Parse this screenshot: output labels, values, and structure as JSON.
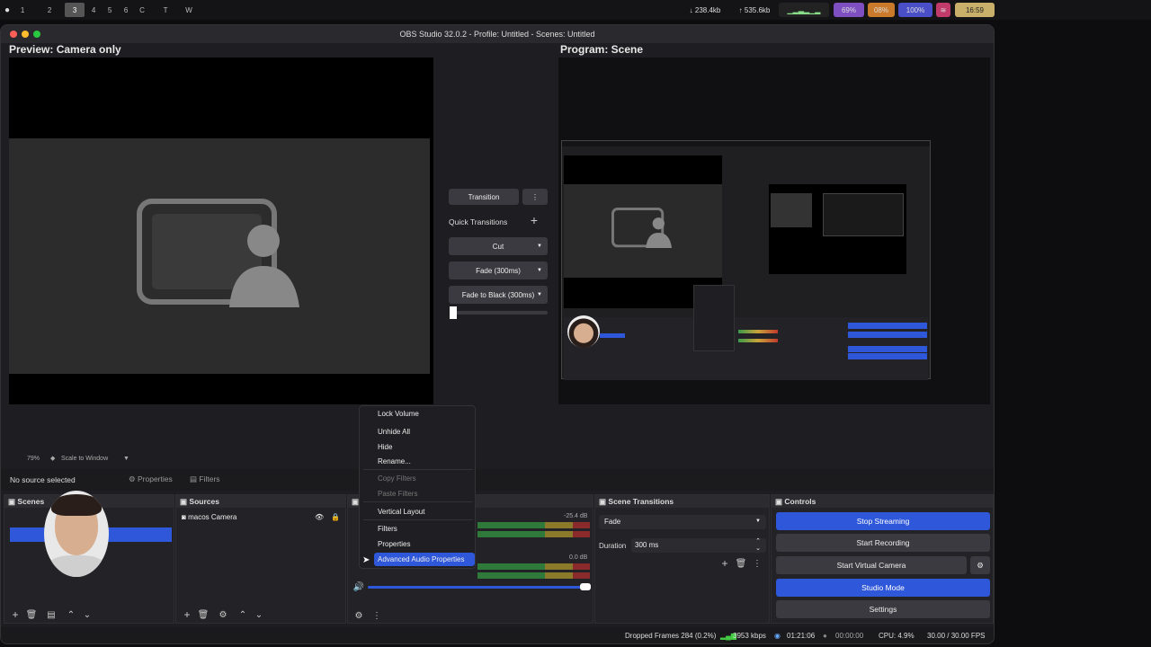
{
  "topbar": {
    "workspaces": [
      "1",
      "2",
      "3",
      "4",
      "5",
      "6",
      "C",
      "T",
      "W"
    ],
    "download": "238.4kb",
    "upload": "535.6kb",
    "battery": "69%",
    "mic": "08%",
    "volume": "100%",
    "time": "16:59"
  },
  "window": {
    "title": "OBS Studio 32.0.2 - Profile: Untitled - Scenes: Untitled"
  },
  "preview": {
    "title": "Preview: Camera only"
  },
  "program": {
    "title": "Program: Scene"
  },
  "transitions_mid": {
    "transition_label": "Transition",
    "quick_label": "Quick Transitions",
    "cut": "Cut",
    "fade": "Fade (300ms)",
    "fade_black": "Fade to Black (300ms)"
  },
  "zoom_bar": {
    "zoom": "79%",
    "scale": "Scale to Window"
  },
  "source_toolbar": {
    "no_source": "No source selected",
    "properties": "Properties",
    "filters": "Filters"
  },
  "docks": {
    "scenes": "Scenes",
    "sources": "Sources",
    "scene_transitions": "Scene Transitions",
    "controls": "Controls"
  },
  "sources": {
    "item": "macos Camera"
  },
  "mixer": {
    "db1": "-25.4 dB",
    "db2": "0.0 dB"
  },
  "scene_transitions": {
    "selected": "Fade",
    "duration_label": "Duration",
    "duration_value": "300 ms"
  },
  "controls": {
    "stop_streaming": "Stop Streaming",
    "start_recording": "Start Recording",
    "start_virtual": "Start Virtual Camera",
    "studio_mode": "Studio Mode",
    "settings": "Settings"
  },
  "context_menu": {
    "items": [
      "Lock Volume",
      "Unhide All",
      "Hide",
      "Rename...",
      "Copy Filters",
      "Paste Filters",
      "Vertical Layout",
      "Filters",
      "Properties",
      "Advanced Audio Properties"
    ]
  },
  "status": {
    "dropped": "Dropped Frames 284 (0.2%)",
    "kbps": "3953 kbps",
    "stream_time": "01:21:06",
    "rec_time": "00:00:00",
    "cpu": "CPU: 4.9%",
    "fps": "30.00 / 30.00 FPS"
  },
  "colors": {
    "accent": "#2f57d9",
    "background": "#1e1e22"
  }
}
